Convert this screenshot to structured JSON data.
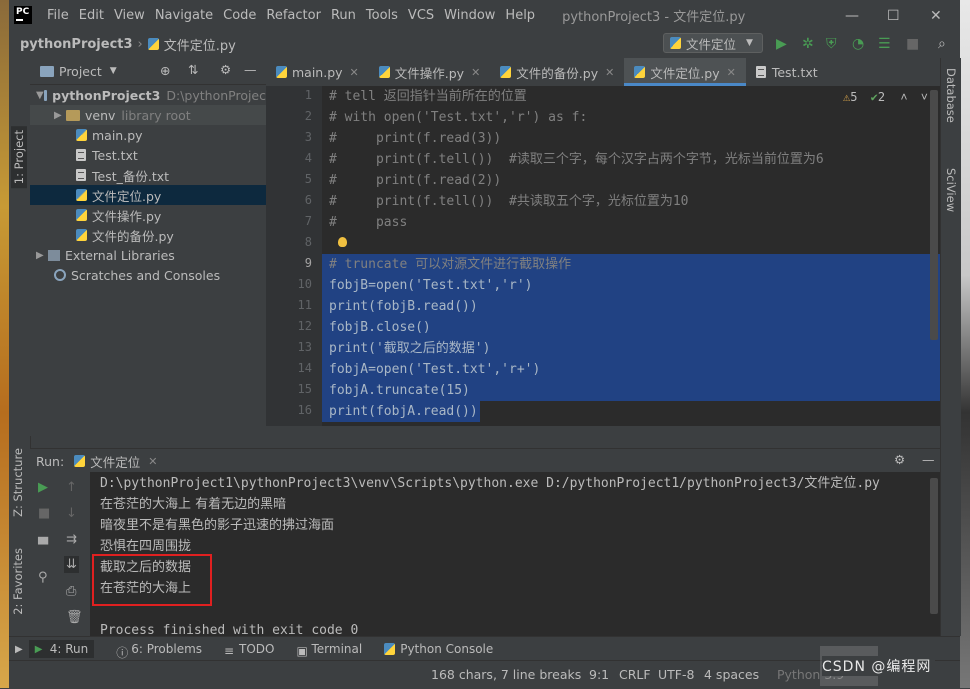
{
  "app": {
    "logo": "PC",
    "menu": [
      "File",
      "Edit",
      "View",
      "Navigate",
      "Code",
      "Refactor",
      "Run",
      "Tools",
      "VCS",
      "Window",
      "Help"
    ],
    "window_title": "pythonProject3 - 文件定位.py"
  },
  "navbar": {
    "project": "pythonProject3",
    "separator": "›",
    "file": "文件定位.py",
    "run_config": "文件定位"
  },
  "left_tabs": {
    "project": "1: Project",
    "structure": "Z: Structure",
    "favorites": "2: Favorites"
  },
  "right_tabs": {
    "database": "Database",
    "sciview": "SciView"
  },
  "project_panel": {
    "title": "Project",
    "items": [
      {
        "label": "pythonProject3",
        "hint": "D:\\pythonProjec"
      },
      {
        "label": "venv",
        "hint": "library root"
      },
      {
        "label": "main.py"
      },
      {
        "label": "Test.txt"
      },
      {
        "label": "Test_备份.txt"
      },
      {
        "label": "文件定位.py"
      },
      {
        "label": "文件操作.py"
      },
      {
        "label": "文件的备份.py"
      },
      {
        "label": "External Libraries"
      },
      {
        "label": "Scratches and Consoles"
      }
    ]
  },
  "tabs": [
    {
      "label": "main.py"
    },
    {
      "label": "文件操作.py"
    },
    {
      "label": "文件的备份.py"
    },
    {
      "label": "文件定位.py"
    },
    {
      "label": "Test.txt"
    }
  ],
  "editor": {
    "inspections": {
      "warnings": "5",
      "weak_warnings": "2"
    },
    "line_numbers": [
      "1",
      "2",
      "3",
      "4",
      "5",
      "6",
      "7",
      "8",
      "9",
      "10",
      "11",
      "12",
      "13",
      "14",
      "15",
      "16"
    ],
    "lines": [
      "# tell 返回指针当前所在的位置",
      "# with open('Test.txt','r') as f:",
      "#     print(f.read(3))",
      "#     print(f.tell())  #读取三个字，每个汉字占两个字节，光标当前位置为6",
      "#     print(f.read(2))",
      "#     print(f.tell())  #共读取五个字，光标位置为10",
      "#     pass",
      "",
      "# truncate 可以对源文件进行截取操作",
      "fobjB=open('Test.txt','r')",
      "print(fobjB.read())",
      "fobjB.close()",
      "print('截取之后的数据')",
      "fobjA=open('Test.txt','r+')",
      "fobjA.truncate(15)",
      "print(fobjA.read())"
    ]
  },
  "run_panel": {
    "label": "Run:",
    "config": "文件定位",
    "output": [
      "D:\\pythonProject1\\pythonProject3\\venv\\Scripts\\python.exe D:/pythonProject1/pythonProject3/文件定位.py",
      "在苍茫的大海上 有着无边的黑暗",
      "暗夜里不是有黑色的影子迅速的拂过海面",
      "恐惧在四周围拢",
      "截取之后的数据",
      "在苍茫的大海上",
      "",
      "Process finished with exit code 0"
    ]
  },
  "bottom_tabs": [
    "4: Run",
    "6: Problems",
    "TODO",
    "Terminal",
    "Python Console"
  ],
  "status": {
    "chars": "168 chars, 7 line breaks",
    "position": "9:1",
    "line_sep": "CRLF",
    "encoding": "UTF-8",
    "indent": "4 spaces",
    "interpreter": "Python 3.9",
    "watermark": "CSDN @编程网"
  },
  "colors": {
    "selection": "#214283",
    "highlight_box": "#e02020",
    "accent": "#4a88c7"
  }
}
